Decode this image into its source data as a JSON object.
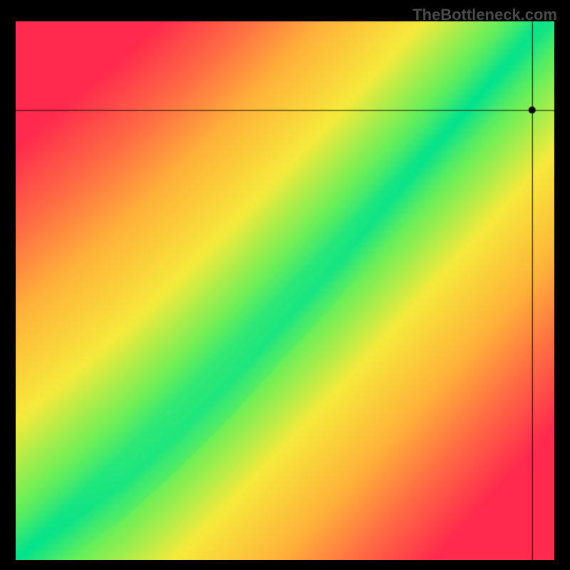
{
  "watermark": "TheBottleneck.com",
  "chart_data": {
    "type": "heatmap",
    "title": "",
    "xlabel": "",
    "ylabel": "",
    "xlim": [
      0,
      100
    ],
    "ylim": [
      0,
      100
    ],
    "grid": false,
    "legend": false,
    "field": "compatibility",
    "description": "Diagonal green band indicates optimal pairing; red indicates bottleneck. Value represents distance from optimal diagonal curve (0=optimal, 1=worst).",
    "optimal_curve_samples": {
      "x": [
        0,
        10,
        20,
        30,
        40,
        50,
        60,
        70,
        80,
        90,
        100
      ],
      "y": [
        0,
        7,
        14,
        23,
        33,
        44,
        55,
        67,
        79,
        91,
        103
      ]
    },
    "band_halfwidth_percent": 7,
    "marker_point": {
      "x": 96,
      "y": 83.5
    },
    "crosshair": {
      "x": 96,
      "y": 83.5
    },
    "colorscale": [
      {
        "stop": 0.0,
        "color": "#00e28d"
      },
      {
        "stop": 0.15,
        "color": "#6bef58"
      },
      {
        "stop": 0.35,
        "color": "#f6ea3b"
      },
      {
        "stop": 0.6,
        "color": "#ffb23a"
      },
      {
        "stop": 0.8,
        "color": "#ff6a44"
      },
      {
        "stop": 1.0,
        "color": "#ff2a4d"
      }
    ]
  }
}
